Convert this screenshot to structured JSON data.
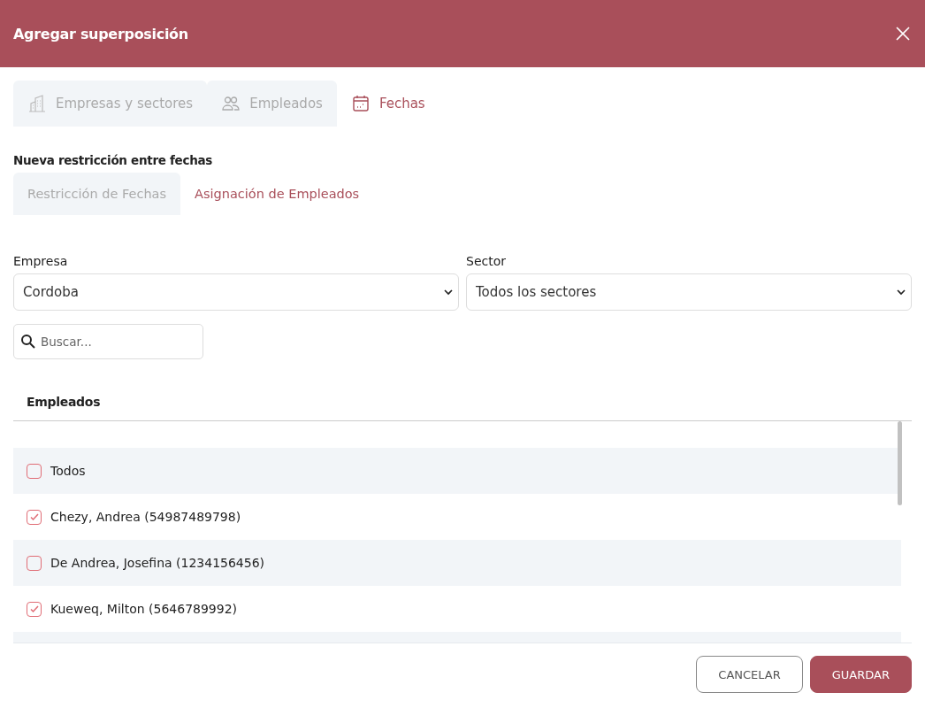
{
  "dialog": {
    "title": "Agregar superposición"
  },
  "tabs": [
    {
      "label": "Empresas y sectores",
      "kind": "building",
      "selected": false
    },
    {
      "label": "Empleados",
      "kind": "people",
      "selected": false
    },
    {
      "label": "Fechas",
      "kind": "calendar",
      "selected": true
    }
  ],
  "section_title": "Nueva restricción entre fechas",
  "subtabs": [
    {
      "label": "Restricción de Fechas",
      "selected": false
    },
    {
      "label": "Asignación de Empleados",
      "selected": true
    }
  ],
  "filters": [
    {
      "label": "Empresa",
      "value": "Cordoba"
    },
    {
      "label": "Sector",
      "value": "Todos los sectores"
    }
  ],
  "search": {
    "placeholder": "Buscar..."
  },
  "list": {
    "heading": "Empleados",
    "rows": [
      {
        "label": "Todos",
        "checked": false
      },
      {
        "label": "Chezy, Andrea (54987489798)",
        "checked": true
      },
      {
        "label": "De Andrea, Josefina (1234156456)",
        "checked": false
      },
      {
        "label": "Kueweq, Milton (5646789992)",
        "checked": true
      }
    ]
  },
  "buttons": [
    {
      "label": "CANCELAR",
      "kind": "secondary"
    },
    {
      "label": "GUARDAR",
      "kind": "primary"
    }
  ]
}
